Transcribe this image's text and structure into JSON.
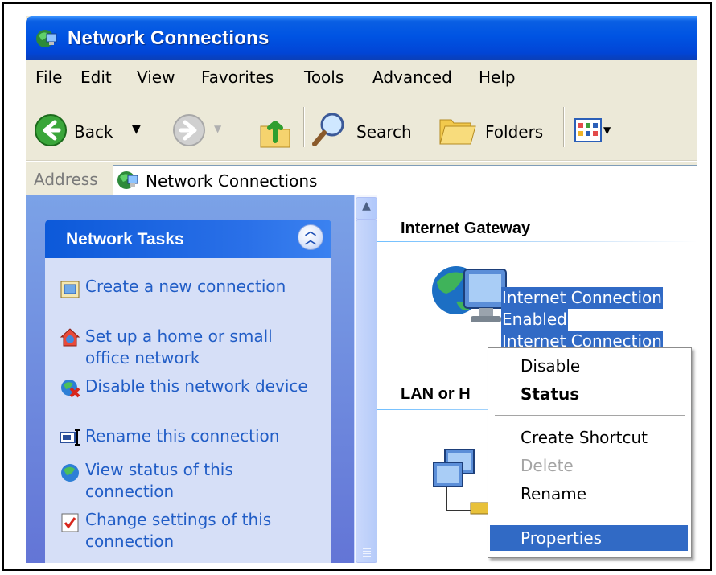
{
  "window": {
    "title": "Network Connections"
  },
  "menubar": {
    "items": [
      "File",
      "Edit",
      "View",
      "Favorites",
      "Tools",
      "Advanced",
      "Help"
    ]
  },
  "toolbar": {
    "back_label": "Back",
    "search_label": "Search",
    "folders_label": "Folders"
  },
  "address": {
    "label": "Address",
    "value": "Network Connections"
  },
  "taskpane": {
    "title": "Network Tasks",
    "tasks": [
      {
        "label": "Create a new connection",
        "icon": "new-connection-icon"
      },
      {
        "label": "Set up a home or small office network",
        "icon": "home-network-icon"
      },
      {
        "label": "Disable this network device",
        "icon": "disable-device-icon"
      },
      {
        "label": "Rename this connection",
        "icon": "rename-icon"
      },
      {
        "label": "View status of this connection",
        "icon": "status-icon"
      },
      {
        "label": "Change settings of this connection",
        "icon": "settings-icon"
      }
    ]
  },
  "content": {
    "group1": "Internet Gateway",
    "group2": "LAN or H",
    "connection": {
      "name": "Internet Connection",
      "status": "Enabled",
      "type": "Internet Connection"
    }
  },
  "context_menu": {
    "items": [
      {
        "label": "Disable",
        "state": "normal"
      },
      {
        "label": "Status",
        "state": "default"
      },
      {
        "label": "Create Shortcut",
        "state": "normal"
      },
      {
        "label": "Delete",
        "state": "disabled"
      },
      {
        "label": "Rename",
        "state": "normal"
      },
      {
        "label": "Properties",
        "state": "selected"
      }
    ]
  },
  "colors": {
    "titlebar": "#0054e3",
    "selection": "#316ac5",
    "task_link": "#215dc6"
  }
}
